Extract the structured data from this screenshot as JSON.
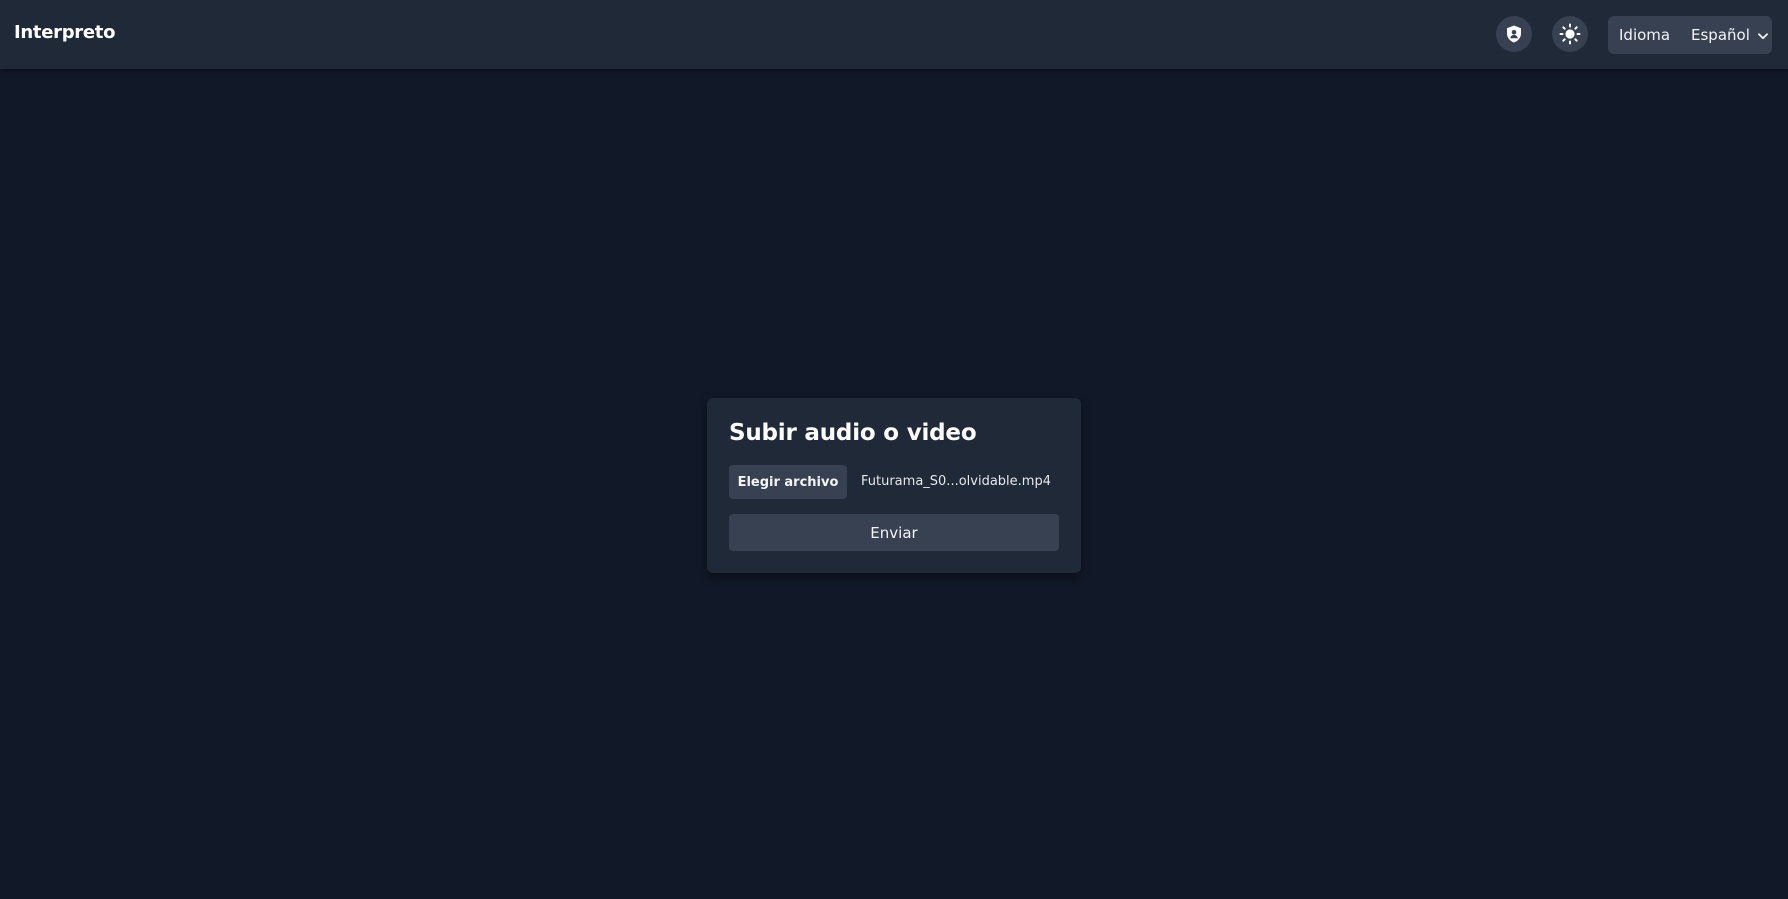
{
  "header": {
    "brand": "Interpreto",
    "privacy_icon": "shield-icon",
    "theme_icon": "sun-icon",
    "language_label": "Idioma",
    "language_selected": "Español"
  },
  "upload": {
    "title": "Subir audio o video",
    "choose_file_label": "Elegir archivo",
    "file_name": "Futurama_S0...olvidable.mp4",
    "submit_label": "Enviar"
  },
  "colors": {
    "background": "#111827",
    "surface": "#1f2937",
    "control": "#374151",
    "text": "#f3f4f6"
  }
}
